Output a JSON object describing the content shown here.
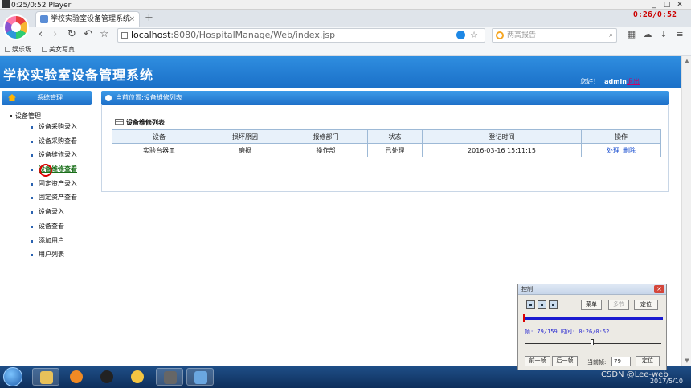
{
  "player": {
    "title": "0:25/0:52 Player",
    "overlay_time": "0:26/0:52"
  },
  "browser": {
    "tab_title": "学校实验室设备管理系统",
    "url_host": "localhost",
    "url_path": ":8080/HospitalManage/Web/index.jsp",
    "search_placeholder": "两高报告",
    "bookmarks": [
      "娱乐场",
      "美女写真"
    ]
  },
  "header": {
    "system_title": "学校实验室设备管理系统",
    "greeting": "您好！",
    "username": "admin",
    "logout": "退出"
  },
  "sidebar": {
    "title": "系统管理",
    "group": "设备管理",
    "items": [
      {
        "label": "设备采购录入"
      },
      {
        "label": "设备采购查看"
      },
      {
        "label": "设备维修录入"
      },
      {
        "label": "设备维修查看"
      },
      {
        "label": "固定资产录入"
      },
      {
        "label": "固定资产查看"
      },
      {
        "label": "设备录入"
      },
      {
        "label": "设备查看"
      },
      {
        "label": "添加用户"
      },
      {
        "label": "用户列表"
      }
    ]
  },
  "content": {
    "breadcrumb": "当前位置:设备维修列表",
    "list_title": "设备维修列表",
    "columns": [
      "设备",
      "损坏原因",
      "报修部门",
      "状态",
      "登记时间",
      "操作"
    ],
    "rows": [
      {
        "device": "实验台器皿",
        "reason": "磨损",
        "dept": "操作部",
        "status": "已处理",
        "time": "2016-03-16 15:11:15",
        "action_edit": "处理",
        "action_delete": "删除"
      }
    ]
  },
  "control_dialog": {
    "title": "控制",
    "menu_button": "菜单",
    "multi_button": "多节",
    "locate_button": "定位",
    "frame_info": "帧: 79/159 时间: 0:26/0:52",
    "prev_frame": "前一帧",
    "next_frame": "后一帧",
    "current_frame_label": "当前帧:",
    "current_frame_value": "79",
    "locate_button_2": "定位"
  },
  "taskbar": {
    "watermark": "CSDN @Lee-web",
    "date": "2017/5/10"
  }
}
